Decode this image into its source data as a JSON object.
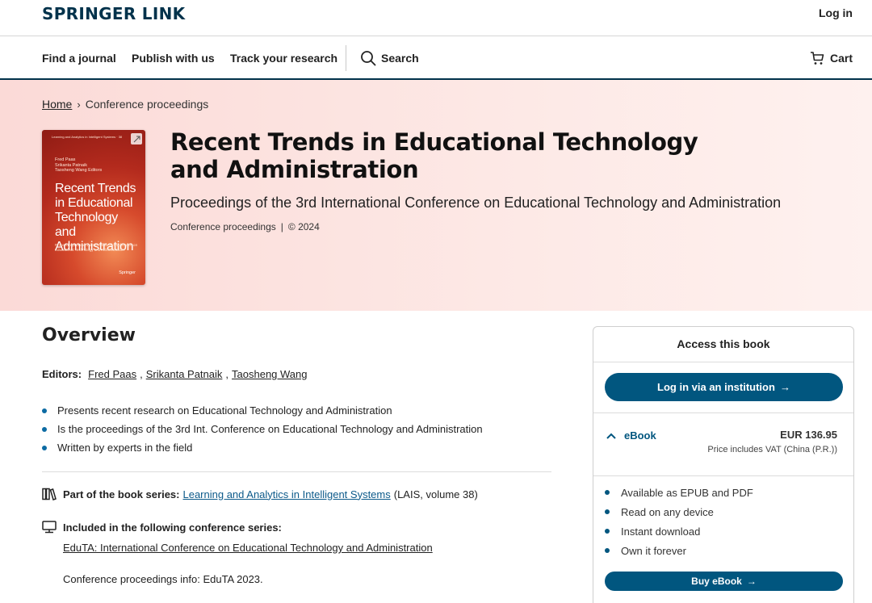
{
  "header": {
    "logo": "SPRINGER LINK",
    "login": "Log in"
  },
  "nav": {
    "links": [
      "Find a journal",
      "Publish with us",
      "Track your research"
    ],
    "search": "Search",
    "cart": "Cart"
  },
  "breadcrumb": {
    "home": "Home",
    "current": "Conference proceedings"
  },
  "cover": {
    "series": "Learning and Analytics in Intelligent Systems · 38",
    "authors": [
      "Fred Paas",
      "Srikanta Patnaik",
      "Taosheng Wang  Editors"
    ],
    "title": "Recent Trends in Educational Technology and Administration",
    "subtitle": "Proceedings of the 3rd International Conference on Educational Technology and Administration",
    "publisher": "Springer"
  },
  "book": {
    "title": "Recent Trends in Educational Technology and Administration",
    "subtitle": "Proceedings of the 3rd International Conference on Educational Technology and Administration",
    "type": "Conference proceedings",
    "separator": "|",
    "year": "© 2024"
  },
  "overview": {
    "heading": "Overview",
    "editors_label": "Editors:",
    "editors": [
      "Fred Paas",
      "Srikanta Patnaik",
      "Taosheng Wang"
    ],
    "bullets": [
      "Presents recent research on Educational Technology and Administration",
      "Is the proceedings of the 3rd Int. Conference on Educational Technology and Administration",
      "Written by experts in the field"
    ],
    "series_label": "Part of the book series:",
    "series_link": "Learning and Analytics in Intelligent Systems",
    "series_detail": "(LAIS, volume 38)",
    "conf_label": "Included in the following conference series:",
    "conf_link": "EduTA: International Conference on Educational Technology and Administration",
    "conf_info": "Conference proceedings info: EduTA 2023."
  },
  "access": {
    "title": "Access this book",
    "institution_button": "Log in via an institution",
    "ebook_label": "eBook",
    "price": "EUR 136.95",
    "price_note": "Price includes VAT (China (P.R.))",
    "features": [
      "Available as EPUB and PDF",
      "Read on any device",
      "Instant download",
      "Own it forever"
    ],
    "buy_button": "Buy eBook"
  },
  "colors": {
    "brand_navy": "#01324b",
    "button_blue": "#01567f",
    "bullet_blue": "#0c6ba3",
    "hero_pink": "#fbdad7"
  }
}
